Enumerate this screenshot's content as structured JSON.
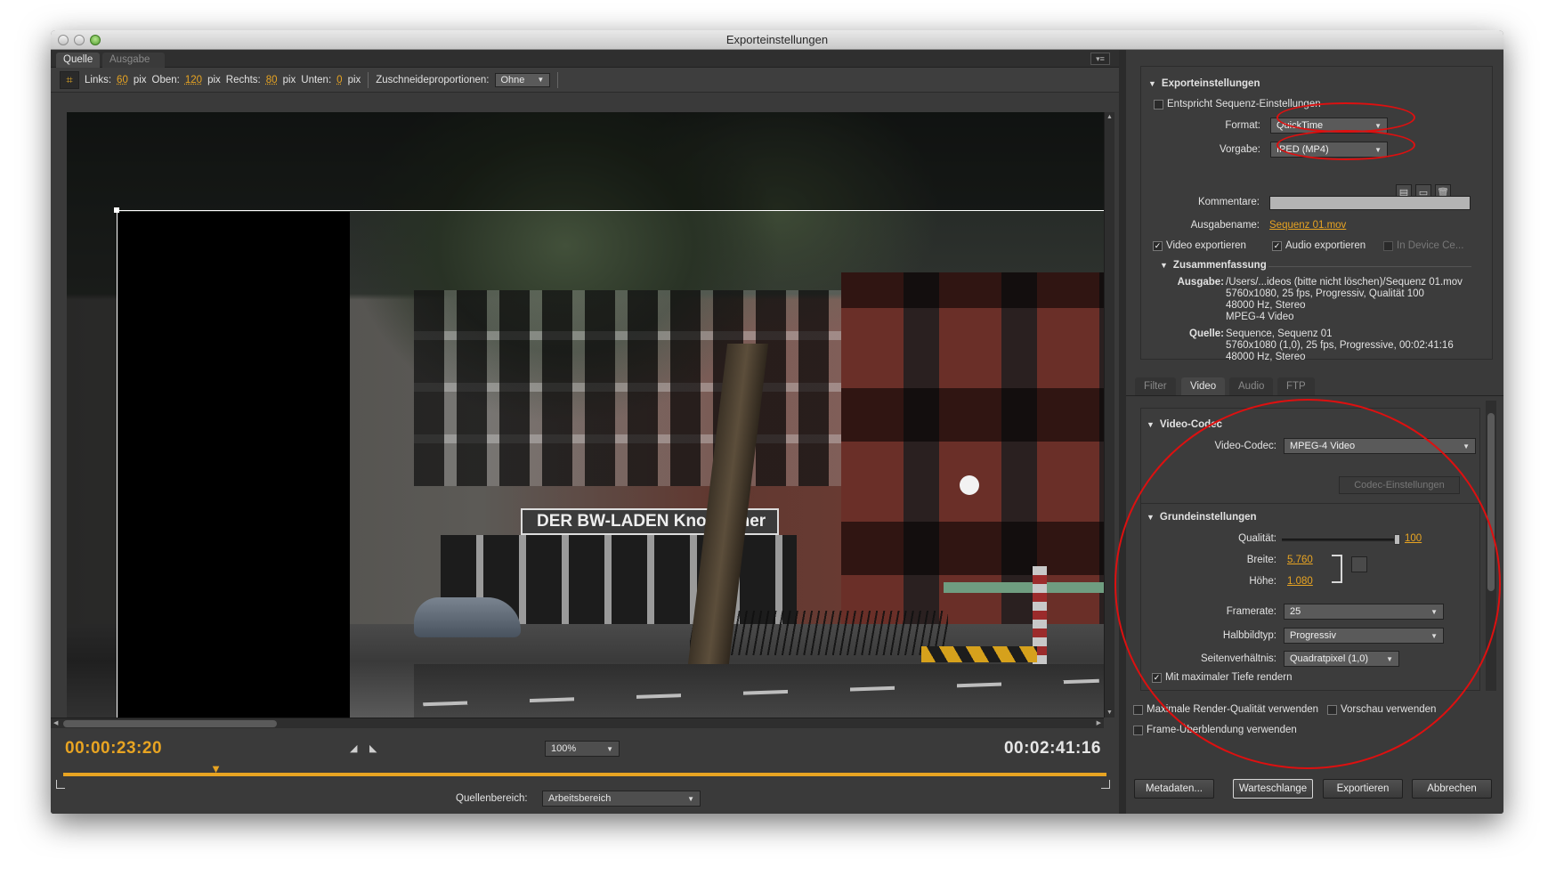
{
  "window": {
    "title": "Exporteinstellungen"
  },
  "left": {
    "tabs": [
      "Quelle",
      "Ausgabe"
    ],
    "crop": {
      "links_label": "Links:",
      "links_value": "60",
      "unit1": "pix",
      "oben_label": "Oben:",
      "oben_value": "120",
      "unit2": "pix",
      "rechts_label": "Rechts:",
      "rechts_value": "80",
      "unit3": "pix",
      "unten_label": "Unten:",
      "unten_value": "0",
      "unit4": "pix",
      "proportions_label": "Zuschneideproportionen:",
      "proportions_value": "Ohne"
    },
    "photo": {
      "sign_text": "DER BW-LADEN Kno...echer"
    },
    "timeline": {
      "current_time": "00:00:23:20",
      "duration": "00:02:41:16",
      "zoom": "100%",
      "playhead_fraction": 0.146,
      "source_range_label": "Quellenbereich:",
      "source_range_value": "Arbeitsbereich"
    }
  },
  "right": {
    "export_section": {
      "header": "Exporteinstellungen",
      "match_sequence": "Entspricht Sequenz-Einstellungen",
      "format_label": "Format:",
      "format_value": "QuickTime",
      "preset_label": "Vorgabe:",
      "preset_value": "IPED (MP4)",
      "comments_label": "Kommentare:",
      "output_name_label": "Ausgabename:",
      "output_name_value": "Sequenz 01.mov",
      "export_video": "Video exportieren",
      "export_audio": "Audio exportieren",
      "device_central": "In Device Ce..."
    },
    "summary": {
      "header": "Zusammenfassung",
      "output_label": "Ausgabe:",
      "output_lines": [
        "/Users/...ideos (bitte nicht löschen)/Sequenz 01.mov",
        "5760x1080, 25 fps, Progressiv, Qualität 100",
        "48000 Hz, Stereo",
        "MPEG-4 Video"
      ],
      "source_label": "Quelle:",
      "source_lines": [
        "Sequence, Sequenz 01",
        "5760x1080 (1,0), 25 fps, Progressive, 00:02:41:16",
        "48000 Hz, Stereo"
      ]
    },
    "tabs": [
      "Filter",
      "Video",
      "Audio",
      "FTP"
    ],
    "video_codec": {
      "header": "Video-Codec",
      "codec_label": "Video-Codec:",
      "codec_value": "MPEG-4 Video",
      "codec_settings_button": "Codec-Einstellungen"
    },
    "basic": {
      "header": "Grundeinstellungen",
      "quality_label": "Qualität:",
      "quality_value": "100",
      "width_label": "Breite:",
      "width_value": "5.760",
      "height_label": "Höhe:",
      "height_value": "1.080",
      "framerate_label": "Framerate:",
      "framerate_value": "25",
      "field_label": "Halbbildtyp:",
      "field_value": "Progressiv",
      "aspect_label": "Seitenverhältnis:",
      "aspect_value": "Quadratpixel (1,0)",
      "max_depth": "Mit maximaler Tiefe rendern"
    },
    "options": {
      "max_quality": "Maximale Render-Qualität verwenden",
      "preview": "Vorschau verwenden",
      "frame_blend": "Frame-Überblendung verwenden"
    },
    "buttons": {
      "metadata": "Metadaten...",
      "queue": "Warteschlange",
      "export": "Exportieren",
      "cancel": "Abbrechen"
    }
  },
  "colors": {
    "accent_orange": "#e8a422",
    "annotation_red": "#dd1010",
    "panel_bg": "#3a3a3a"
  },
  "icons": [
    "crop-icon",
    "panel-menu-icon",
    "save-preset-icon",
    "import-preset-icon",
    "delete-preset-icon",
    "playhead-icon",
    "chain-link-icon"
  ]
}
